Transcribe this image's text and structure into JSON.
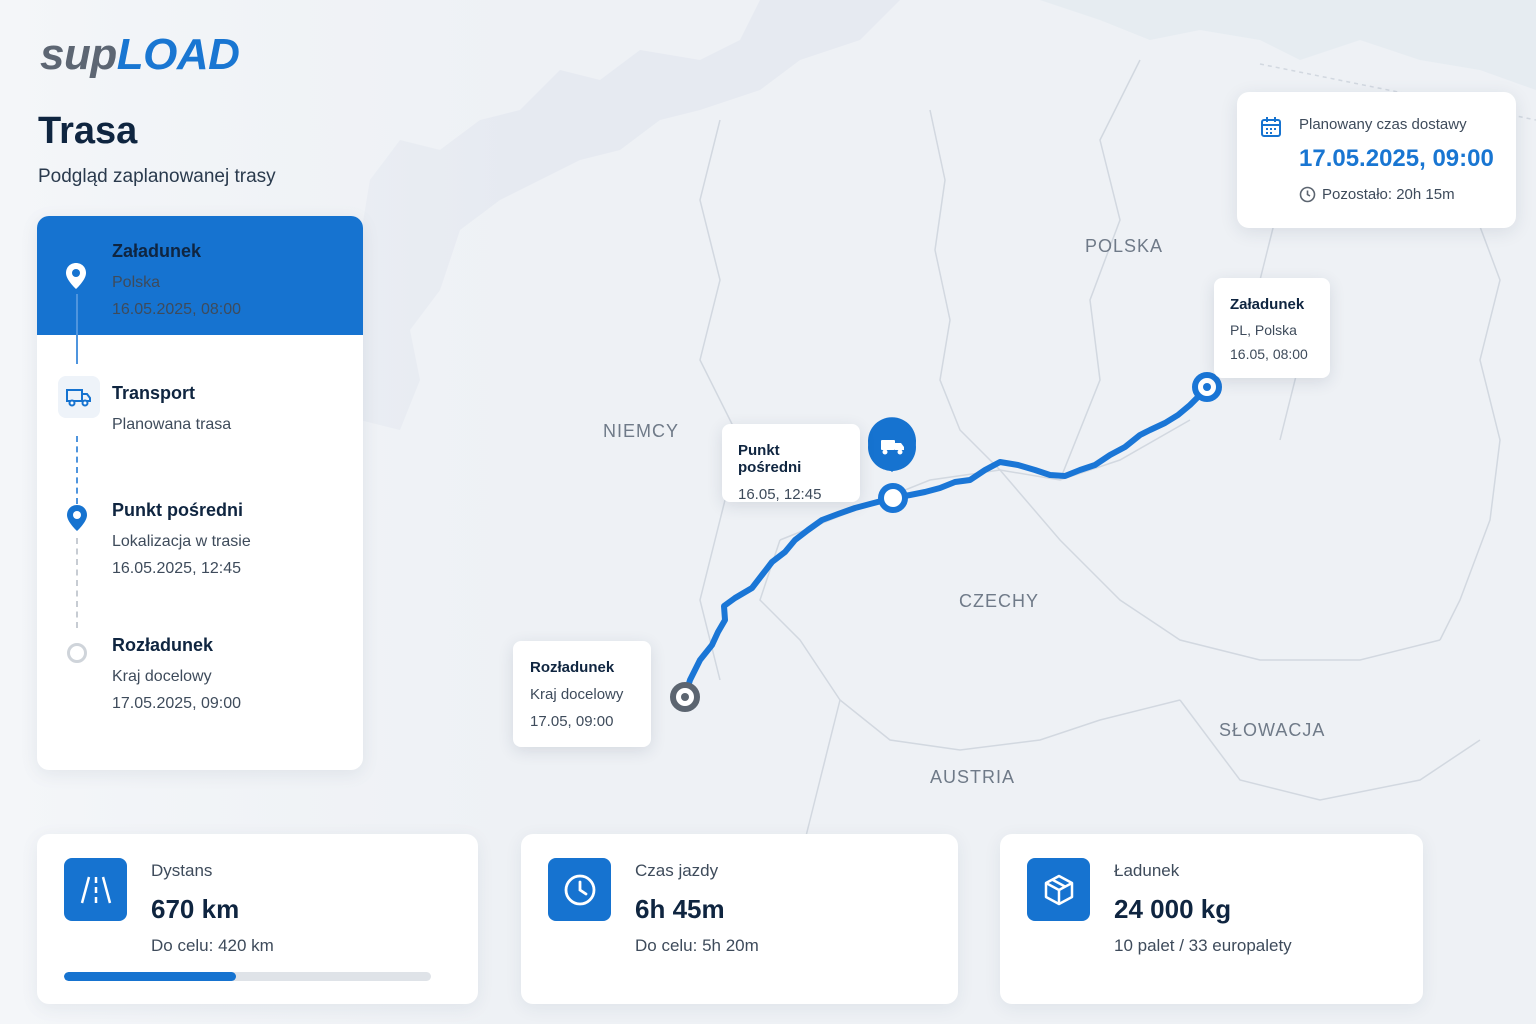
{
  "brand": {
    "part1": "sup",
    "part2": "LOAD"
  },
  "page": {
    "title": "Trasa",
    "subtitle": "Podgląd zaplanowanej trasy"
  },
  "route_steps": [
    {
      "title": "Załadunek",
      "line1": "Polska",
      "line2": "16.05.2025, 08:00",
      "icon": "location-pin-icon",
      "active": true
    },
    {
      "title": "Transport",
      "line1": "Planowana trasa",
      "line2": "",
      "icon": "truck-icon"
    },
    {
      "title": "Punkt pośredni",
      "line1": "Lokalizacja w trasie",
      "line2": "16.05.2025, 12:45",
      "icon": "location-pin-icon"
    },
    {
      "title": "Rozładunek",
      "line1": "Kraj docelowy",
      "line2": "17.05.2025, 09:00",
      "icon": "circle-outline-icon"
    }
  ],
  "delivery": {
    "label": "Planowany czas dostawy",
    "value": "17.05.2025, 09:00",
    "remaining": "Pozostało: 20h 15m"
  },
  "map": {
    "countries": [
      "POLSKA",
      "NIEMCY",
      "CZECHY",
      "SŁOWACJA",
      "AUSTRIA"
    ],
    "popups": {
      "start": {
        "title": "Załadunek",
        "line1": "PL, Polska",
        "line2": "16.05, 08:00"
      },
      "mid": {
        "title": "Punkt pośredni",
        "line1": "16.05, 12:45"
      },
      "end": {
        "title": "Rozładunek",
        "line1": "Kraj docelowy",
        "line2": "17.05, 09:00"
      }
    }
  },
  "stats": {
    "distance": {
      "label": "Dystans",
      "value": "670 km",
      "sub": "Do celu: 420 km",
      "progress": 0.47
    },
    "time": {
      "label": "Czas jazdy",
      "value": "6h 45m",
      "sub": "Do celu: 5h 20m"
    },
    "cargo": {
      "label": "Ładunek",
      "value": "24 000 kg",
      "sub": "10 palet / 33 europalety"
    }
  },
  "colors": {
    "accent": "#1673d0",
    "text": "#0f2540",
    "route": "#1976d2"
  }
}
